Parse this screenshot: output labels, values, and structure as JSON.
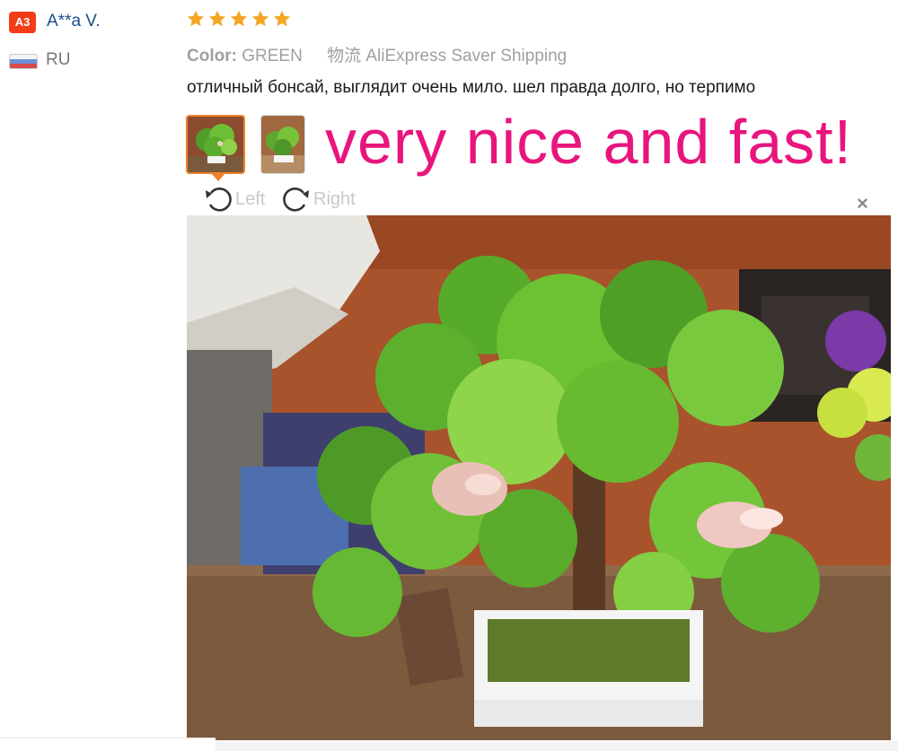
{
  "reviewer": {
    "avatar_initials": "A3",
    "name": "A**a V.",
    "country": "RU"
  },
  "rating": {
    "stars": 5,
    "max": 5,
    "color": "#f5a623"
  },
  "meta": {
    "color_label": "Color:",
    "color_value": "GREEN",
    "shipping": "物流 AliExpress Saver Shipping"
  },
  "review_text": "отличный бонсай, выглядит очень мило. шел правда долго, но терпимо",
  "overlay_text": "very nice and fast!",
  "viewer": {
    "rotate_left_label": "Left",
    "rotate_right_label": "Right",
    "close_icon": "close-icon"
  },
  "colors": {
    "accent_orange": "#f0812a",
    "overlay_pink": "#e8157d",
    "name_blue": "#1a4d8c",
    "avatar_red": "#f23d18"
  }
}
